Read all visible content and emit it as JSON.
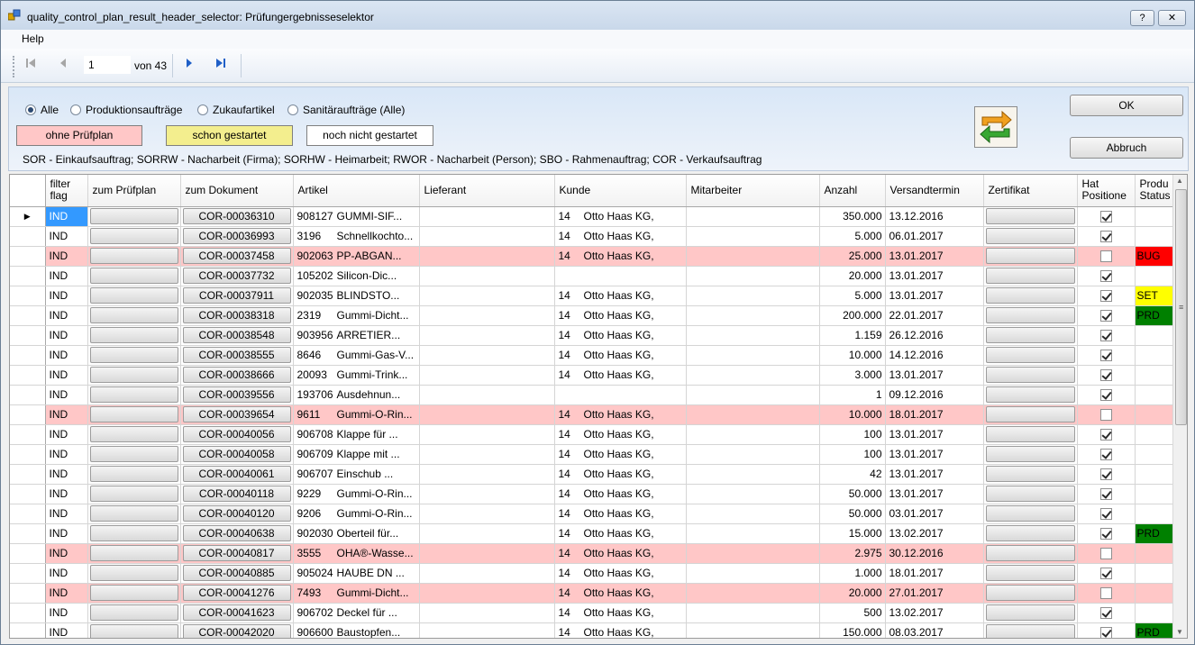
{
  "window": {
    "title": "quality_control_plan_result_header_selector: Prüfungergebnisseselektor",
    "help_btn": "?",
    "close_btn": "✕",
    "icon": "app-icon"
  },
  "menu": {
    "help": "Help"
  },
  "pager": {
    "current": "1",
    "of_label": "von 43"
  },
  "filter": {
    "radios": [
      "Alle",
      "Produktionsaufträge",
      "Zukaufartikel",
      "Sanitäraufträge (Alle)"
    ],
    "selected": "Alle",
    "legend": [
      {
        "label": "ohne Prüfplan",
        "color": "#ffc7c7"
      },
      {
        "label": "schon gestartet",
        "color": "#f3ee8e"
      },
      {
        "label": "noch nicht gestartet",
        "color": "#ffffff"
      }
    ],
    "note": "SOR - Einkaufsauftrag; SORRW - Nacharbeit (Firma);  SORHW - Heimarbeit; RWOR - Nacharbeit (Person); SBO - Rahmenauftrag;  COR - Verkaufsauftrag"
  },
  "buttons": {
    "ok": "OK",
    "cancel": "Abbruch"
  },
  "grid": {
    "columns": [
      "filter flag",
      "zum Prüfplan",
      "zum Dokument",
      "Artikel",
      "Lieferant",
      "Kunde",
      "Mitarbeiter",
      "Anzahl",
      "Versandtermin",
      "Zertifikat",
      "Hat Positione",
      "Produ Status"
    ],
    "status_colors": {
      "BUG": "#ff0000",
      "SET": "#ffff00",
      "PRD": "#008000"
    },
    "rows": [
      {
        "flag": "IND",
        "doc": "COR-00036310",
        "art_code": "908127",
        "art_name": "GUMMI-SIF...",
        "kunde_no": "14",
        "kunde": "Otto Haas KG,",
        "anzahl": "350.000",
        "termin": "13.12.2016",
        "has_pos": true,
        "status": "",
        "pink": false
      },
      {
        "flag": "IND",
        "doc": "COR-00036993",
        "art_code": "3196",
        "art_name": "Schnellkochto...",
        "kunde_no": "14",
        "kunde": "Otto Haas KG,",
        "anzahl": "5.000",
        "termin": "06.01.2017",
        "has_pos": true,
        "status": "",
        "pink": false
      },
      {
        "flag": "IND",
        "doc": "COR-00037458",
        "art_code": "902063",
        "art_name": "PP-ABGAN...",
        "kunde_no": "14",
        "kunde": "Otto Haas KG,",
        "anzahl": "25.000",
        "termin": "13.01.2017",
        "has_pos": false,
        "status": "BUG",
        "pink": true
      },
      {
        "flag": "IND",
        "doc": "COR-00037732",
        "art_code": "105202",
        "art_name": "Silicon-Dic...",
        "kunde_no": "",
        "kunde": "",
        "anzahl": "20.000",
        "termin": "13.01.2017",
        "has_pos": true,
        "status": "",
        "pink": false
      },
      {
        "flag": "IND",
        "doc": "COR-00037911",
        "art_code": "902035",
        "art_name": "BLINDSTO...",
        "kunde_no": "14",
        "kunde": "Otto Haas KG,",
        "anzahl": "5.000",
        "termin": "13.01.2017",
        "has_pos": true,
        "status": "SET",
        "pink": false
      },
      {
        "flag": "IND",
        "doc": "COR-00038318",
        "art_code": "2319",
        "art_name": "Gummi-Dicht...",
        "kunde_no": "14",
        "kunde": "Otto Haas KG,",
        "anzahl": "200.000",
        "termin": "22.01.2017",
        "has_pos": true,
        "status": "PRD",
        "pink": false
      },
      {
        "flag": "IND",
        "doc": "COR-00038548",
        "art_code": "903956",
        "art_name": "ARRETIER...",
        "kunde_no": "14",
        "kunde": "Otto Haas KG,",
        "anzahl": "1.159",
        "termin": "26.12.2016",
        "has_pos": true,
        "status": "",
        "pink": false
      },
      {
        "flag": "IND",
        "doc": "COR-00038555",
        "art_code": "8646",
        "art_name": "Gummi-Gas-V...",
        "kunde_no": "14",
        "kunde": "Otto Haas KG,",
        "anzahl": "10.000",
        "termin": "14.12.2016",
        "has_pos": true,
        "status": "",
        "pink": false
      },
      {
        "flag": "IND",
        "doc": "COR-00038666",
        "art_code": "20093",
        "art_name": "Gummi-Trink...",
        "kunde_no": "14",
        "kunde": "Otto Haas KG,",
        "anzahl": "3.000",
        "termin": "13.01.2017",
        "has_pos": true,
        "status": "",
        "pink": false
      },
      {
        "flag": "IND",
        "doc": "COR-00039556",
        "art_code": "193706",
        "art_name": "Ausdehnun...",
        "kunde_no": "",
        "kunde": "",
        "anzahl": "1",
        "termin": "09.12.2016",
        "has_pos": true,
        "status": "",
        "pink": false
      },
      {
        "flag": "IND",
        "doc": "COR-00039654",
        "art_code": "9611",
        "art_name": "Gummi-O-Rin...",
        "kunde_no": "14",
        "kunde": "Otto Haas KG,",
        "anzahl": "10.000",
        "termin": "18.01.2017",
        "has_pos": false,
        "status": "",
        "pink": true
      },
      {
        "flag": "IND",
        "doc": "COR-00040056",
        "art_code": "906708",
        "art_name": "Klappe für ...",
        "kunde_no": "14",
        "kunde": "Otto Haas KG,",
        "anzahl": "100",
        "termin": "13.01.2017",
        "has_pos": true,
        "status": "",
        "pink": false
      },
      {
        "flag": "IND",
        "doc": "COR-00040058",
        "art_code": "906709",
        "art_name": "Klappe mit ...",
        "kunde_no": "14",
        "kunde": "Otto Haas KG,",
        "anzahl": "100",
        "termin": "13.01.2017",
        "has_pos": true,
        "status": "",
        "pink": false
      },
      {
        "flag": "IND",
        "doc": "COR-00040061",
        "art_code": "906707",
        "art_name": "Einschub ...",
        "kunde_no": "14",
        "kunde": "Otto Haas KG,",
        "anzahl": "42",
        "termin": "13.01.2017",
        "has_pos": true,
        "status": "",
        "pink": false
      },
      {
        "flag": "IND",
        "doc": "COR-00040118",
        "art_code": "9229",
        "art_name": "Gummi-O-Rin...",
        "kunde_no": "14",
        "kunde": "Otto Haas KG,",
        "anzahl": "50.000",
        "termin": "13.01.2017",
        "has_pos": true,
        "status": "",
        "pink": false
      },
      {
        "flag": "IND",
        "doc": "COR-00040120",
        "art_code": "9206",
        "art_name": "Gummi-O-Rin...",
        "kunde_no": "14",
        "kunde": "Otto Haas KG,",
        "anzahl": "50.000",
        "termin": "03.01.2017",
        "has_pos": true,
        "status": "",
        "pink": false
      },
      {
        "flag": "IND",
        "doc": "COR-00040638",
        "art_code": "902030",
        "art_name": "Oberteil für...",
        "kunde_no": "14",
        "kunde": "Otto Haas KG,",
        "anzahl": "15.000",
        "termin": "13.02.2017",
        "has_pos": true,
        "status": "PRD",
        "pink": false
      },
      {
        "flag": "IND",
        "doc": "COR-00040817",
        "art_code": "3555",
        "art_name": "OHA®-Wasse...",
        "kunde_no": "14",
        "kunde": "Otto Haas KG,",
        "anzahl": "2.975",
        "termin": "30.12.2016",
        "has_pos": false,
        "status": "",
        "pink": true
      },
      {
        "flag": "IND",
        "doc": "COR-00040885",
        "art_code": "905024",
        "art_name": "HAUBE DN ...",
        "kunde_no": "14",
        "kunde": "Otto Haas KG,",
        "anzahl": "1.000",
        "termin": "18.01.2017",
        "has_pos": true,
        "status": "",
        "pink": false
      },
      {
        "flag": "IND",
        "doc": "COR-00041276",
        "art_code": "7493",
        "art_name": "Gummi-Dicht...",
        "kunde_no": "14",
        "kunde": "Otto Haas KG,",
        "anzahl": "20.000",
        "termin": "27.01.2017",
        "has_pos": false,
        "status": "",
        "pink": true
      },
      {
        "flag": "IND",
        "doc": "COR-00041623",
        "art_code": "906702",
        "art_name": "Deckel für ...",
        "kunde_no": "14",
        "kunde": "Otto Haas KG,",
        "anzahl": "500",
        "termin": "13.02.2017",
        "has_pos": true,
        "status": "",
        "pink": false
      },
      {
        "flag": "IND",
        "doc": "COR-00042020",
        "art_code": "906600",
        "art_name": "Baustopfen...",
        "kunde_no": "14",
        "kunde": "Otto Haas KG,",
        "anzahl": "150.000",
        "termin": "08.03.2017",
        "has_pos": true,
        "status": "PRD",
        "pink": false
      }
    ]
  }
}
